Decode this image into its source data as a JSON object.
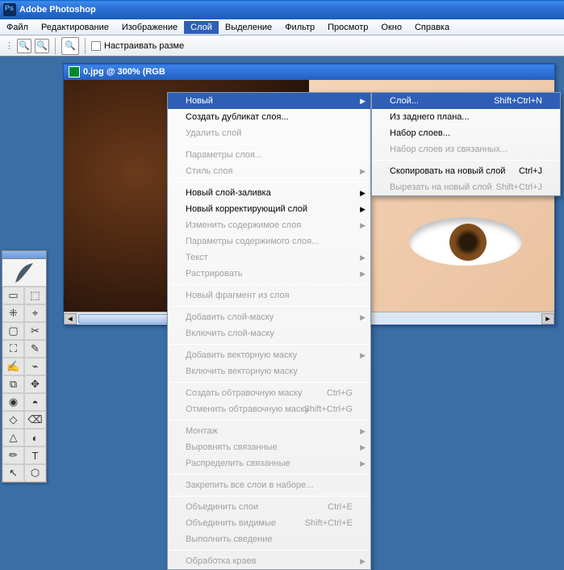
{
  "title": "Adobe Photoshop",
  "menubar": [
    "Файл",
    "Редактирование",
    "Изображение",
    "Слой",
    "Выделение",
    "Фильтр",
    "Просмотр",
    "Окно",
    "Справка"
  ],
  "menubar_active_index": 3,
  "optbar": {
    "checkbox_label": "Настраивать разме"
  },
  "doc": {
    "title": "0.jpg @ 300% (RGB"
  },
  "tools": [
    "▭",
    "⬚",
    "⁜",
    "⌖",
    "▢",
    "✂",
    "⛶",
    "✎",
    "✍",
    "⌁",
    "⧉",
    "✥",
    "◉",
    "◓",
    "◇",
    "⌫",
    "△",
    "◐",
    "✏",
    "T",
    "↖",
    "⬡"
  ],
  "layer_menu": [
    {
      "label": "Новый",
      "submenu": true,
      "highlight": true
    },
    {
      "label": "Создать дубликат слоя..."
    },
    {
      "label": "Удалить слой",
      "disabled": true
    },
    {
      "sep": true
    },
    {
      "label": "Параметры слоя...",
      "disabled": true
    },
    {
      "label": "Стиль слоя",
      "submenu": true,
      "disabled": true
    },
    {
      "sep": true
    },
    {
      "label": "Новый слой-заливка",
      "submenu": true
    },
    {
      "label": "Новый корректирующий слой",
      "submenu": true
    },
    {
      "label": "Изменить содержимое слоя",
      "submenu": true,
      "disabled": true
    },
    {
      "label": "Параметры содержимого слоя...",
      "disabled": true
    },
    {
      "label": "Текст",
      "submenu": true,
      "disabled": true
    },
    {
      "label": "Растрировать",
      "submenu": true,
      "disabled": true
    },
    {
      "sep": true
    },
    {
      "label": "Новый фрагмент из слоя",
      "disabled": true
    },
    {
      "sep": true
    },
    {
      "label": "Добавить слой-маску",
      "submenu": true,
      "disabled": true
    },
    {
      "label": "Включить слой-маску",
      "disabled": true
    },
    {
      "sep": true
    },
    {
      "label": "Добавить векторную маску",
      "submenu": true,
      "disabled": true
    },
    {
      "label": "Включить векторную маску",
      "disabled": true
    },
    {
      "sep": true
    },
    {
      "label": "Создать обтравочную маску",
      "shortcut": "Ctrl+G",
      "disabled": true
    },
    {
      "label": "Отменить обтравочную маску",
      "shortcut": "Shift+Ctrl+G",
      "disabled": true
    },
    {
      "sep": true
    },
    {
      "label": "Монтаж",
      "submenu": true,
      "disabled": true
    },
    {
      "label": "Выровнять связанные",
      "submenu": true,
      "disabled": true
    },
    {
      "label": "Распределить связанные",
      "submenu": true,
      "disabled": true
    },
    {
      "sep": true
    },
    {
      "label": "Закрепить все слои в наборе...",
      "disabled": true
    },
    {
      "sep": true
    },
    {
      "label": "Объединить слои",
      "shortcut": "Ctrl+E",
      "disabled": true
    },
    {
      "label": "Объединить видимые",
      "shortcut": "Shift+Ctrl+E",
      "disabled": true
    },
    {
      "label": "Выполнить сведение",
      "disabled": true
    },
    {
      "sep": true
    },
    {
      "label": "Обработка краев",
      "submenu": true,
      "disabled": true
    }
  ],
  "submenu": [
    {
      "label": "Слой...",
      "shortcut": "Shift+Ctrl+N",
      "highlight": true
    },
    {
      "label": "Из заднего плана..."
    },
    {
      "label": "Набор слоев..."
    },
    {
      "label": "Набор слоев из связанных...",
      "disabled": true
    },
    {
      "sep": true
    },
    {
      "label": "Скопировать на новый слой",
      "shortcut": "Ctrl+J"
    },
    {
      "label": "Вырезать на новый слой",
      "shortcut": "Shift+Ctrl+J",
      "disabled": true
    }
  ]
}
